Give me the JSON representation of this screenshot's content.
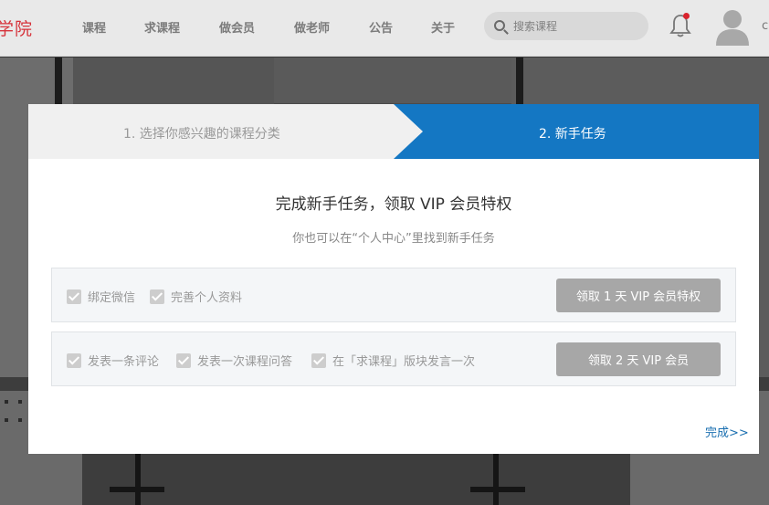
{
  "brand": {
    "logo_text": "学院",
    "accent": "#d6333b"
  },
  "nav": {
    "items": [
      {
        "label": "课程"
      },
      {
        "label": "求课程"
      },
      {
        "label": "做会员"
      },
      {
        "label": "做老师"
      },
      {
        "label": "公告"
      },
      {
        "label": "关于"
      }
    ]
  },
  "search": {
    "placeholder": "搜索课程",
    "icon": "search-icon"
  },
  "header": {
    "bell_icon": "bell-icon",
    "avatar_icon": "user-avatar-icon",
    "user_name_cut": "c"
  },
  "modal": {
    "steps": [
      {
        "label": "1. 选择你感兴趣的课程分类",
        "active": false
      },
      {
        "label": "2. 新手任务",
        "active": true
      }
    ],
    "active_color": "#1477c3",
    "title": "完成新手任务，领取 VIP 会员特权",
    "subtitle": "你也可以在“个人中心”里找到新手任务",
    "task_groups": [
      {
        "tasks": [
          {
            "label": "绑定微信",
            "checked": true
          },
          {
            "label": "完善个人资料",
            "checked": true
          }
        ],
        "button_label": "领取 1 天 VIP 会员特权"
      },
      {
        "tasks": [
          {
            "label": "发表一条评论",
            "checked": true
          },
          {
            "label": "发表一次课程问答",
            "checked": true
          },
          {
            "label": "在「求课程」版块发言一次",
            "checked": true
          }
        ],
        "button_label": "领取 2 天 VIP 会员"
      }
    ],
    "done_link": "完成>>"
  }
}
